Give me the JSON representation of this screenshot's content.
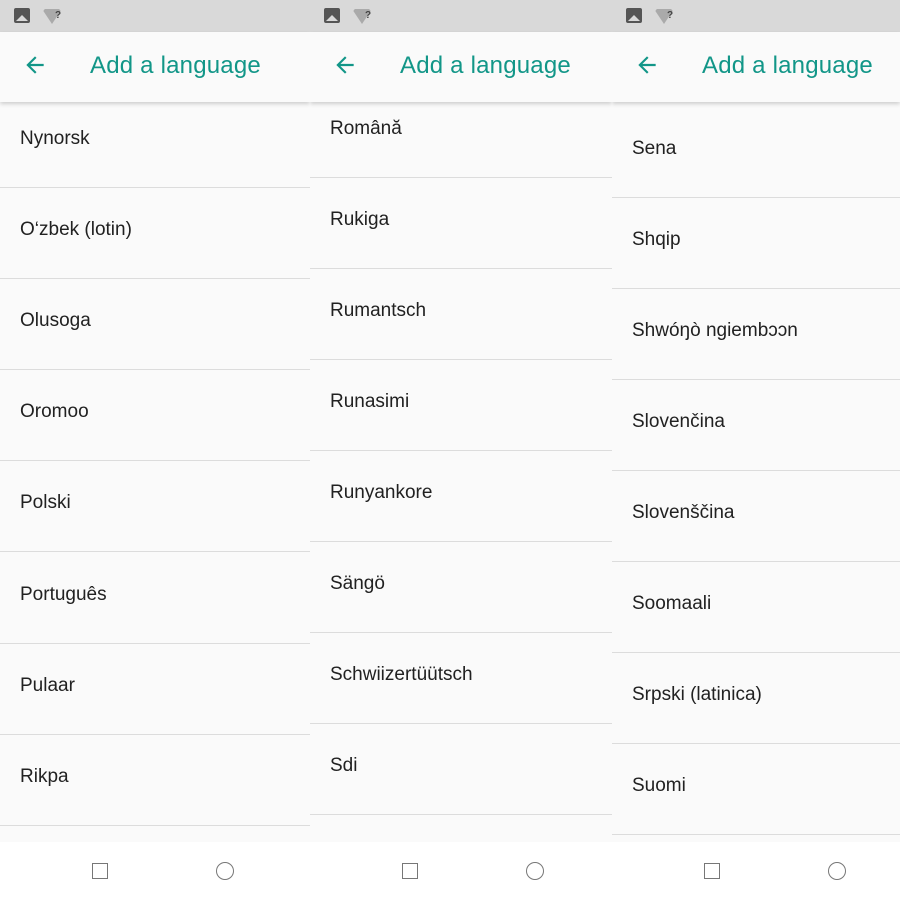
{
  "colors": {
    "accent": "#129688",
    "text": "#212121",
    "statusbar": "#d9d9d9"
  },
  "icons": {
    "status_image": "image-icon",
    "status_wifi": "wifi-unknown-icon",
    "back": "arrow-left-icon",
    "nav_recents": "square-icon",
    "nav_home": "circle-icon"
  },
  "status_wifi_mark": "?",
  "screens": [
    {
      "title": "Add a language",
      "items": [
        "Nynorsk",
        "O‘zbek (lotin)",
        "Olusoga",
        "Oromoo",
        "Polski",
        "Português",
        "Pulaar",
        "Rikpa"
      ]
    },
    {
      "title": "Add a language",
      "items": [
        "Română",
        "Rukiga",
        "Rumantsch",
        "Runasimi",
        "Runyankore",
        "Sängö",
        "Schwiizertüütsch",
        "Sdi"
      ]
    },
    {
      "title": "Add a language",
      "items": [
        "Sena",
        "Shqip",
        "Shwóŋò ngiembɔɔn",
        "Slovenčina",
        "Slovenščina",
        "Soomaali",
        "Srpski (latinica)",
        "Suomi"
      ]
    }
  ]
}
